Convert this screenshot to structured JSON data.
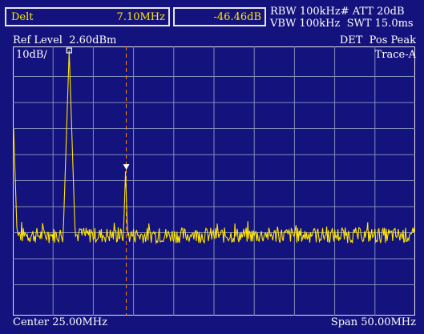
{
  "marker": {
    "mode": "Delt",
    "frequency": "7.10MHz",
    "level": "-46.46dB"
  },
  "settings": {
    "line1": "RBW 100kHz# ATT 20dB",
    "line2": "VBW 100kHz  SWT 15.0ms"
  },
  "header": {
    "ref_level": "Ref Level  2.60dBm",
    "detector": "DET  Pos Peak",
    "scale": "10dB/",
    "trace": "Trace-A"
  },
  "footer": {
    "center": "Center 25.00MHz",
    "span": "Span 50.00MHz"
  },
  "colors": {
    "background": "#14127c",
    "grid": "#7f8dbb",
    "trace": "#ffe600",
    "frame": "#e6e6e6",
    "marker_line": "#ff8a00"
  },
  "chart_data": {
    "type": "line",
    "x_unit": "MHz",
    "y_unit": "dB",
    "xlim": [
      0,
      50
    ],
    "ylim": [
      -100,
      0
    ],
    "grid": true,
    "noise_floor_db": -71,
    "peaks": [
      {
        "x": 0.1,
        "y": -30
      },
      {
        "x": 7.0,
        "y": 0
      },
      {
        "x": 14.0,
        "y": -46.46
      }
    ],
    "markers": [
      {
        "kind": "reference",
        "x": 7.0,
        "y": 0,
        "symbol": "square"
      },
      {
        "kind": "delta",
        "x": 14.1,
        "y": -46.46,
        "symbol": "triangle-down"
      }
    ],
    "display_line_x": 14.1
  }
}
